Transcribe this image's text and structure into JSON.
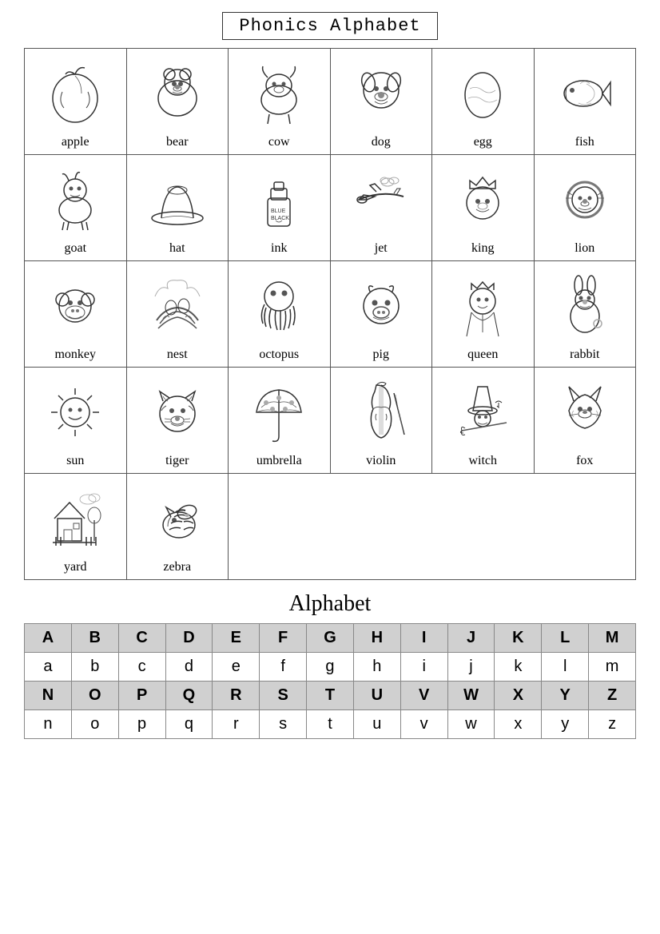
{
  "title": "Phonics Alphabet",
  "alphabet_title": "Alphabet",
  "cells": [
    {
      "label": "apple",
      "emoji": "🍎"
    },
    {
      "label": "bear",
      "emoji": "🐻"
    },
    {
      "label": "cow",
      "emoji": "🐄"
    },
    {
      "label": "dog",
      "emoji": "🐶"
    },
    {
      "label": "egg",
      "emoji": "🥚"
    },
    {
      "label": "fish",
      "emoji": "🐟"
    },
    {
      "label": "goat",
      "emoji": "🐐"
    },
    {
      "label": "hat",
      "emoji": "🎩"
    },
    {
      "label": "ink",
      "emoji": "🖊"
    },
    {
      "label": "jet",
      "emoji": "✈"
    },
    {
      "label": "king",
      "emoji": "👑"
    },
    {
      "label": "lion",
      "emoji": "🦁"
    },
    {
      "label": "monkey",
      "emoji": "🐒"
    },
    {
      "label": "nest",
      "emoji": "🪺"
    },
    {
      "label": "octopus",
      "emoji": "🐙"
    },
    {
      "label": "pig",
      "emoji": "🐷"
    },
    {
      "label": "queen",
      "emoji": "👸"
    },
    {
      "label": "rabbit",
      "emoji": "🐰"
    },
    {
      "label": "sun",
      "emoji": "☀"
    },
    {
      "label": "tiger",
      "emoji": "🐯"
    },
    {
      "label": "umbrella",
      "emoji": "☂"
    },
    {
      "label": "violin",
      "emoji": "🎻"
    },
    {
      "label": "witch",
      "emoji": "🧙"
    },
    {
      "label": "fox",
      "emoji": "🦊"
    },
    {
      "label": "yard",
      "emoji": "🏡"
    },
    {
      "label": "zebra",
      "emoji": "🦓"
    }
  ],
  "alphabet_upper": [
    "A",
    "B",
    "C",
    "D",
    "E",
    "F",
    "G",
    "H",
    "I",
    "J",
    "K",
    "L",
    "M"
  ],
  "alphabet_lower_1": [
    "a",
    "b",
    "c",
    "d",
    "e",
    "f",
    "g",
    "h",
    "i",
    "j",
    "k",
    "l",
    "m"
  ],
  "alphabet_upper_2": [
    "N",
    "O",
    "P",
    "Q",
    "R",
    "S",
    "T",
    "U",
    "V",
    "W",
    "X",
    "Y",
    "Z"
  ],
  "alphabet_lower_2": [
    "n",
    "o",
    "p",
    "q",
    "r",
    "s",
    "t",
    "u",
    "v",
    "w",
    "x",
    "y",
    "z"
  ]
}
